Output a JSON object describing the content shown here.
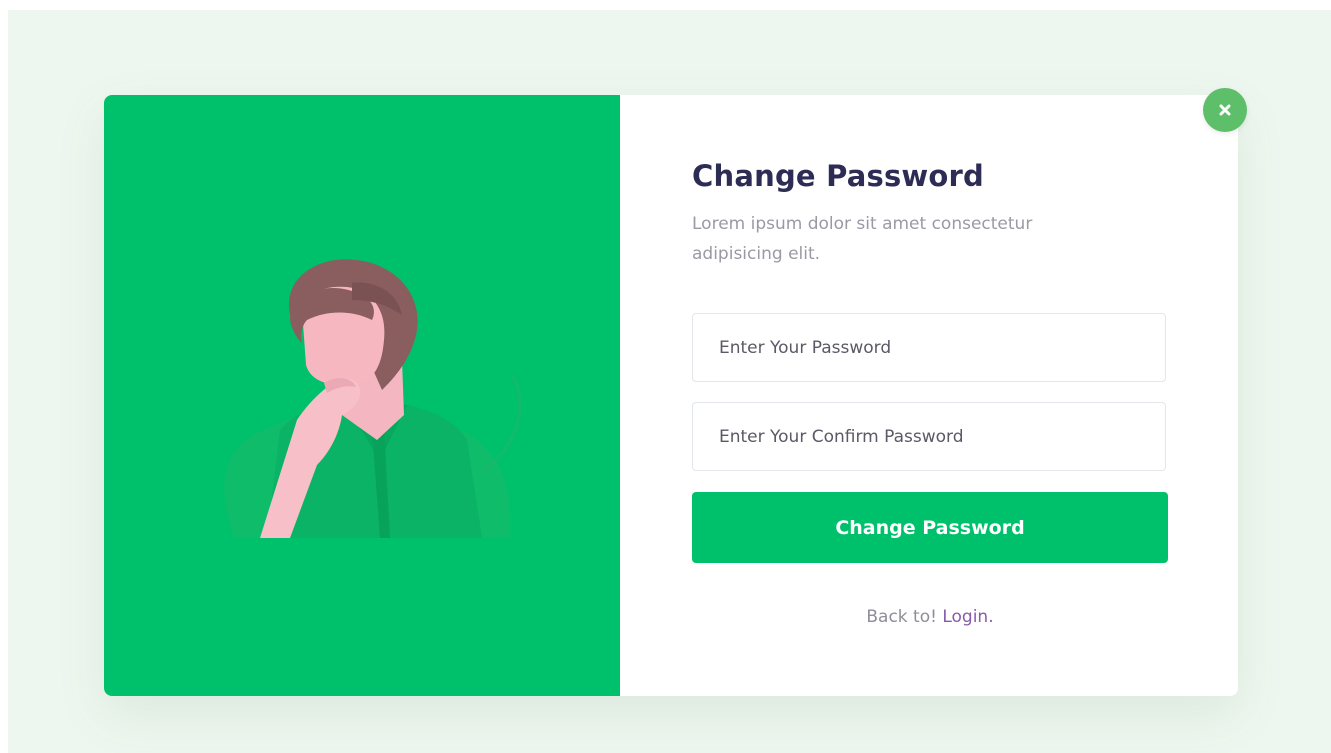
{
  "modal": {
    "title": "Change Password",
    "subtitle": "Lorem ipsum dolor sit amet consectetur adipisicing elit.",
    "password_placeholder": "Enter Your Password",
    "confirm_placeholder": "Enter Your Confirm Password",
    "submit_label": "Change Password",
    "back_text": "Back to!",
    "login_link": "Login."
  },
  "icons": {
    "close": "close-icon",
    "illustration": "thinking-person-illustration"
  },
  "colors": {
    "accent": "#00c16b",
    "title": "#2c2c55",
    "link": "#8a5aa9",
    "close_button": "#5dbf6a",
    "background": "#eef7ef"
  }
}
